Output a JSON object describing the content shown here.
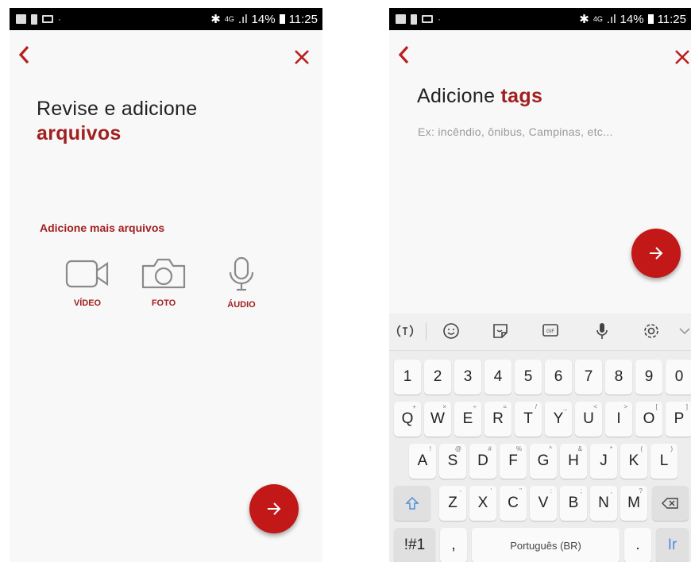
{
  "status_bar": {
    "network": "4G",
    "battery": "14%",
    "time": "11:25"
  },
  "left_screen": {
    "back_icon": "chevron-left",
    "close_icon": "close",
    "title_line1": "Revise e adicione",
    "title_accent": "arquivos",
    "section_label": "Adicione mais arquivos",
    "media_options": [
      {
        "icon": "video-camera-icon",
        "label": "VÍDEO"
      },
      {
        "icon": "camera-icon",
        "label": "FOTO"
      },
      {
        "icon": "microphone-icon",
        "label": "ÁUDIO"
      }
    ],
    "next_button_icon": "arrow-right"
  },
  "right_screen": {
    "back_icon": "chevron-left",
    "close_icon": "close",
    "title_plain": "Adicione ",
    "title_accent": "tags",
    "input_placeholder": "Ex: incêndio, ônibus, Campinas, etc...",
    "next_button_icon": "arrow-right",
    "keyboard": {
      "toolbar": [
        "text-mode-icon",
        "emoji-icon",
        "sticker-icon",
        "gif-icon",
        "microphone-icon",
        "settings-icon",
        "chevron-down-icon"
      ],
      "gif_label": "GIF",
      "number_row": [
        "1",
        "2",
        "3",
        "4",
        "5",
        "6",
        "7",
        "8",
        "9",
        "0"
      ],
      "row1": [
        "Q",
        "W",
        "E",
        "R",
        "T",
        "Y",
        "U",
        "I",
        "O",
        "P"
      ],
      "row1_hints": [
        "+",
        "×",
        "÷",
        "=",
        "/",
        "_",
        "<",
        ">",
        "[",
        "]"
      ],
      "row2": [
        "A",
        "S",
        "D",
        "F",
        "G",
        "H",
        "J",
        "K",
        "L"
      ],
      "row2_hints": [
        "!",
        "@",
        "#",
        "%",
        "^",
        "&",
        "*",
        "(",
        ")"
      ],
      "row3": [
        "Z",
        "X",
        "C",
        "V",
        "B",
        "N",
        "M"
      ],
      "row3_hints": [
        "-",
        "'",
        "\"",
        ":",
        ";",
        ",",
        "?"
      ],
      "symbols_key": "!#1",
      "comma_key": ",",
      "space_label": "Português (BR)",
      "period_key": ".",
      "enter_label": "Ir"
    }
  }
}
